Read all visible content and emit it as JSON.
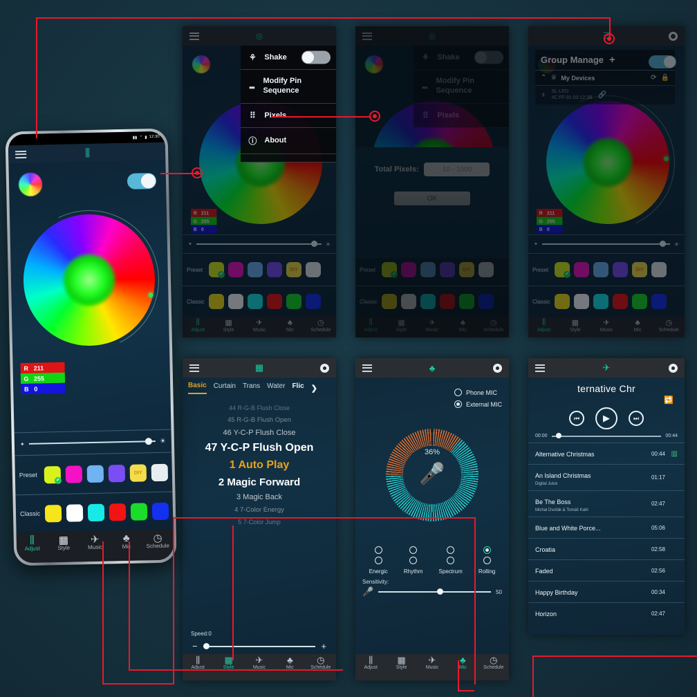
{
  "background_color": "#16323e",
  "annotation_color": "#e8192c",
  "app": {
    "nav_items": [
      "Adjust",
      "Style",
      "Music",
      "Mic",
      "Schedule"
    ],
    "nav_icons": [
      "sliders-icon",
      "grid-icon",
      "music-note-icon",
      "microphone-icon",
      "clock-icon"
    ],
    "appbar": {
      "menu_icon": "hamburger-menu-icon",
      "settings_icon": "gear-icon",
      "power_icon": "power-icon"
    }
  },
  "main_phone": {
    "status_time": "12:30",
    "title_icon": "sliders-icon",
    "color_wheel": "color-wheel",
    "toggle_on": true,
    "rgb": {
      "r_label": "R",
      "r_value": "211",
      "g_label": "G",
      "g_value": "255",
      "b_label": "B",
      "b_value": "0"
    },
    "brightness": {
      "min_icon": "dim-icon",
      "max_icon": "bright-icon",
      "value_pct": 92
    },
    "preset_label": "Preset",
    "preset_colors": [
      "#d8f21b",
      "#f312c5",
      "#6fb3f2",
      "#7a4df5",
      "#f4dd4a",
      "#e9edf0"
    ],
    "preset_selected_index": 0,
    "preset_badge_text": "DIY",
    "classic_label": "Classic",
    "classic_colors": [
      "#f5e51a",
      "#ffffff",
      "#18e8e8",
      "#f21414",
      "#1bdb2b",
      "#1330f0"
    ],
    "active_nav": "Adjust"
  },
  "panel_menu": {
    "items": [
      {
        "label": "Shake",
        "icon": "shake-icon",
        "has_toggle": true,
        "toggle_on": false
      },
      {
        "label": "Modify Pin Sequence",
        "icon": "pin-sequence-icon",
        "has_toggle": false
      },
      {
        "label": "Pixels",
        "icon": "pixels-icon",
        "has_toggle": false
      },
      {
        "label": "About",
        "icon": "info-icon",
        "has_toggle": false
      }
    ]
  },
  "pixels_dialog": {
    "label": "Total Pixels:",
    "input_placeholder": "10 - 1000",
    "input_value": "",
    "ok_label": "OK"
  },
  "group_manage": {
    "title": "Group Manage",
    "add_label": "+",
    "collapse_icon": "chevron-up-icon",
    "devices_icon": "bulbs-icon",
    "devices_label": "My Devices",
    "refresh_icon": "refresh-icon",
    "lock_icon": "lock-icon",
    "device_row": {
      "bulb_icon": "bulb-icon",
      "name": "SL-LED",
      "sub": "4C:FF:91:00:12:3B",
      "link_icon": "link-icon"
    }
  },
  "style_panel": {
    "title_icon": "grid-icon",
    "tabs": [
      "Basic",
      "Curtain",
      "Trans",
      "Water",
      "Flic"
    ],
    "active_tab": "Basic",
    "more_icon": "chevron-right-icon",
    "effects": [
      "44 R-G-B Flush Close",
      "45 R-G-B Flush Open",
      "46 Y-C-P Flush Close",
      "47 Y-C-P Flush Open",
      "1 Auto Play",
      "2 Magic Forward",
      "3 Magic Back",
      "4 7-Color Energy",
      "5 7-Color Jump"
    ],
    "highlighted_effect": "1 Auto Play",
    "speed_label": "Speed:0",
    "speed_minus": "−",
    "speed_plus": "+",
    "speed_value_pct": 0,
    "active_nav": "Style"
  },
  "mic_panel": {
    "title_icon": "microphone-icon",
    "sources": [
      {
        "label": "Phone MIC",
        "selected": false
      },
      {
        "label": "External MIC",
        "selected": true
      }
    ],
    "level_pct": "36%",
    "level_value": 36,
    "mic_icon": "microphone-icon",
    "modes": [
      "Energic",
      "Rhythm",
      "Spectrum",
      "Rolling"
    ],
    "selected_mode": "Rolling",
    "sensitivity_label": "Sensitivity:",
    "sensitivity_value": "50",
    "sensitivity_icon": "microphone-icon",
    "active_nav": "Mic"
  },
  "music_panel": {
    "title_icon": "music-note-icon",
    "now_playing": "ternative Chr",
    "loop_icon": "repeat-icon",
    "prev_icon": "skip-back-icon",
    "play_icon": "play-icon",
    "next_icon": "skip-forward-icon",
    "elapsed": "00:00",
    "duration": "00:44",
    "tracks": [
      {
        "name": "Alternative Christmas",
        "artist": "",
        "time": "00:44",
        "icon": "equalizer-icon"
      },
      {
        "name": "An Island Christmas",
        "artist": "Digital Juice",
        "time": "01:17",
        "icon": ""
      },
      {
        "name": "Be The Boss",
        "artist": "Michal Dvořák & Tomáš Kahl",
        "time": "02:47",
        "icon": ""
      },
      {
        "name": "Blue and White Porce...",
        "artist": "",
        "time": "05:06",
        "icon": ""
      },
      {
        "name": "Croatia",
        "artist": "",
        "time": "02:58",
        "icon": ""
      },
      {
        "name": "Faded",
        "artist": "",
        "time": "02:56",
        "icon": ""
      },
      {
        "name": "Happy Birthday",
        "artist": "",
        "time": "00:34",
        "icon": ""
      },
      {
        "name": "Horizon",
        "artist": "",
        "time": "02:47",
        "icon": ""
      }
    ],
    "active_nav": "Music"
  },
  "secondary_panels": {
    "preset_label": "Preset",
    "classic_label": "Classic",
    "preset_colors": [
      "#d8f21b",
      "#f312c5",
      "#6fb3f2",
      "#7a4df5",
      "#f4dd4a",
      "#e9edf0"
    ],
    "classic_colors": [
      "#f5e51a",
      "#ffffff",
      "#18e8e8",
      "#f21414",
      "#1bdb2b",
      "#1330f0"
    ],
    "preset_badge_text": "DIY"
  }
}
